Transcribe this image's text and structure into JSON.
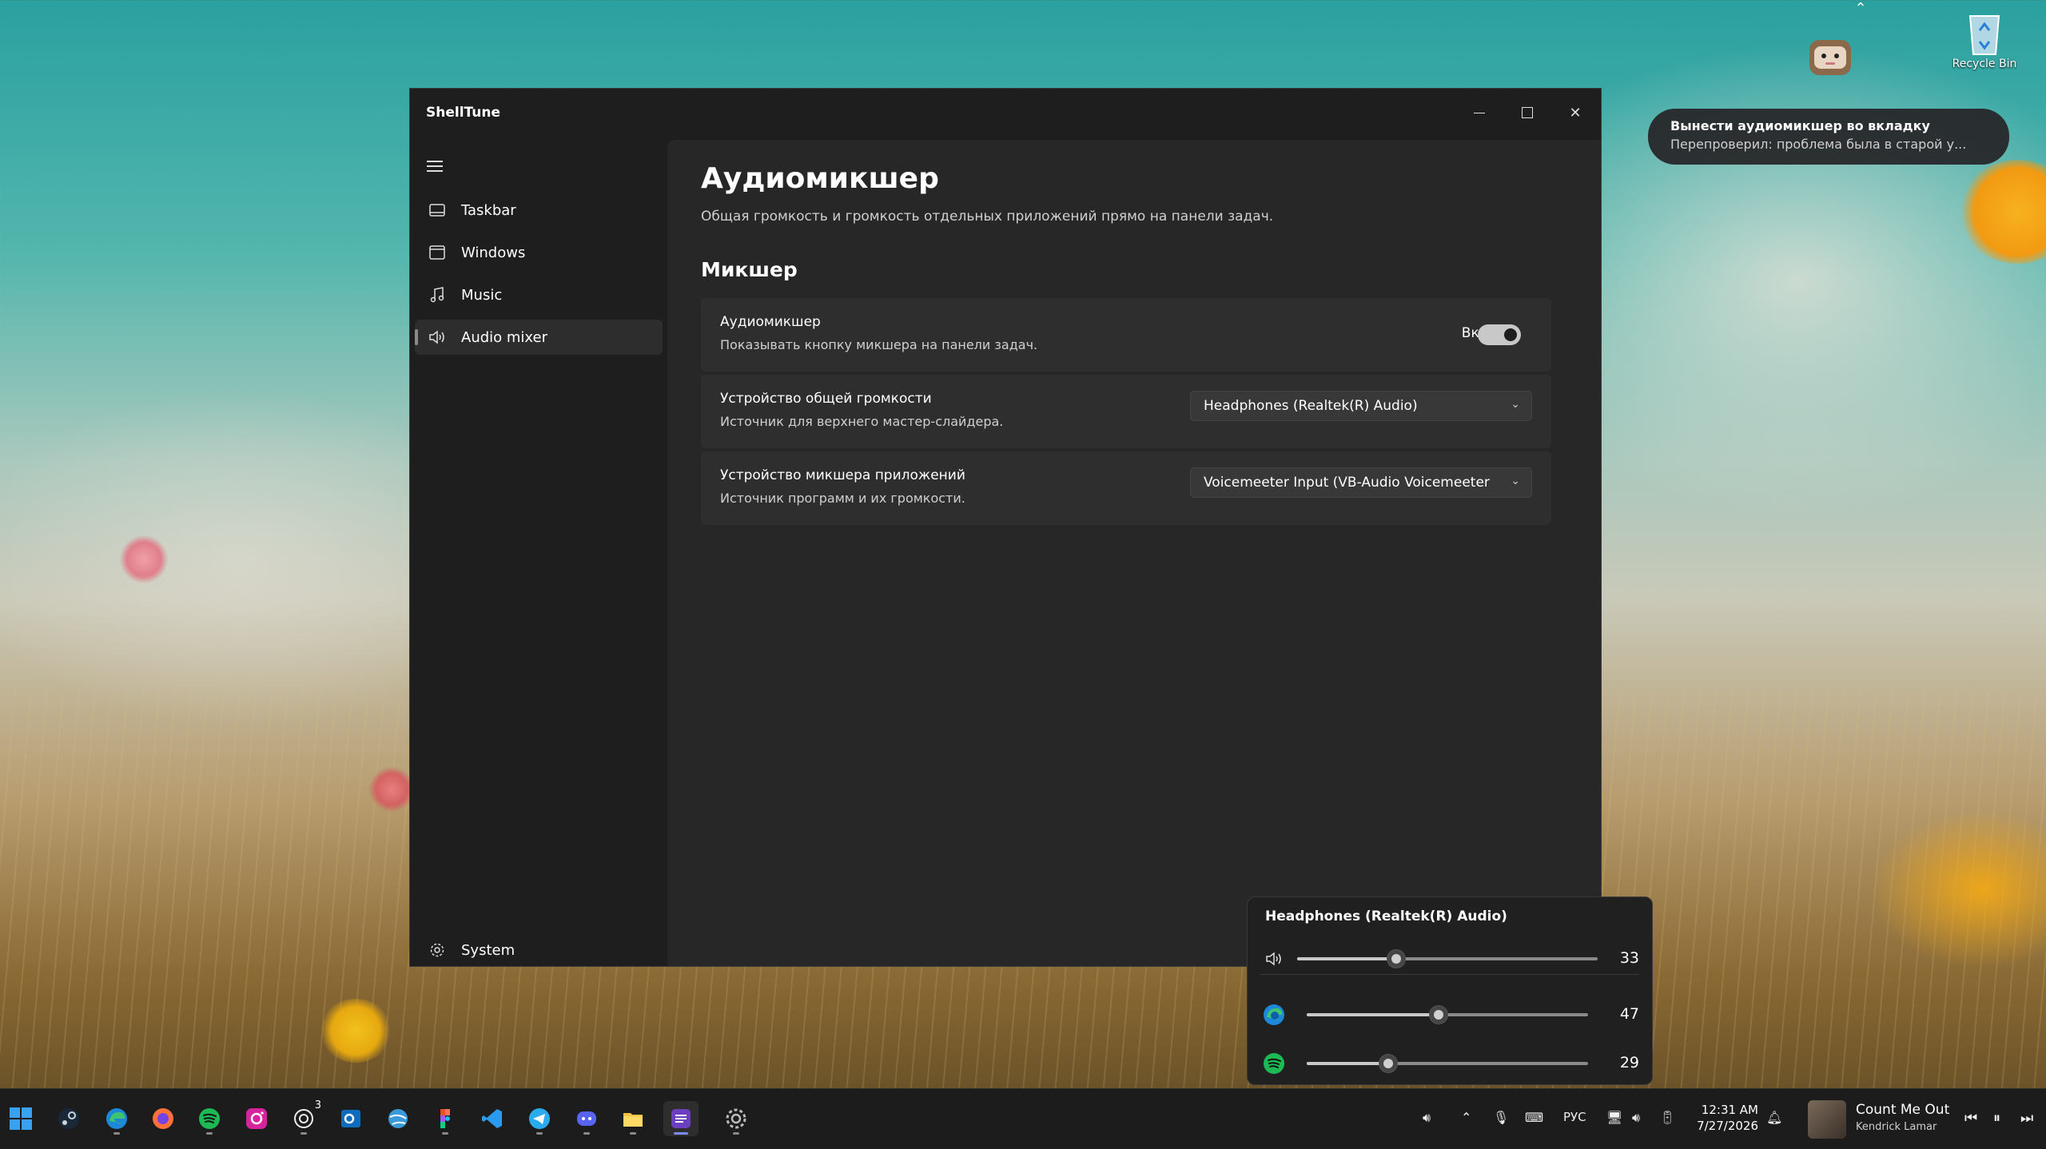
{
  "desktop": {
    "recycle_bin_label": "Recycle Bin"
  },
  "notification": {
    "title": "Вынести аудиомикшер во вкладку",
    "body": "Перепроверил: проблема была в старой у..."
  },
  "window": {
    "title": "ShellTune",
    "controls": {
      "minimize": "—",
      "maximize": "☐",
      "close": "✕"
    }
  },
  "sidebar": {
    "items": [
      {
        "label": "Taskbar",
        "icon": "taskbar-icon"
      },
      {
        "label": "Windows",
        "icon": "window-icon"
      },
      {
        "label": "Music",
        "icon": "music-note-icon"
      },
      {
        "label": "Audio mixer",
        "icon": "speaker-icon",
        "active": true
      }
    ],
    "footer": {
      "label": "System",
      "icon": "gear-icon"
    }
  },
  "page": {
    "title": "Аудиомикшер",
    "subtitle": "Общая громкость и громкость отдельных приложений прямо на панели задач.",
    "section_title": "Микшер",
    "cards": {
      "mixer_toggle": {
        "header": "Аудиомикшер",
        "description": "Показывать кнопку микшера на панели задач.",
        "state_label": "Вкл.",
        "on": true
      },
      "master_device": {
        "header": "Устройство общей громкости",
        "description": "Источник для верхнего мастер-слайдера.",
        "selected": "Headphones (Realtek(R) Audio)"
      },
      "app_device": {
        "header": "Устройство микшера приложений",
        "description": "Источник программ и их громкости.",
        "selected": "Voicemeeter Input (VB-Audio Voicemeeter VAIO)"
      }
    }
  },
  "mixer_flyout": {
    "device_name": "Headphones (Realtek(R) Audio)",
    "master": {
      "icon": "speaker-icon",
      "value": 33
    },
    "apps": [
      {
        "icon": "edge-icon",
        "value": 47
      },
      {
        "icon": "spotify-icon",
        "value": 29
      }
    ]
  },
  "taskbar": {
    "tray": {
      "language": "РУС",
      "time": "12:31 AM",
      "date": "7/27/2026"
    },
    "media": {
      "song": "Count Me Out",
      "artist": "Kendrick Lamar"
    },
    "badge_count": "3"
  },
  "colors": {
    "accent": "#7c8cff",
    "window_bg": "#1e1e1e",
    "content_bg": "#272727",
    "card_bg": "#2e2e2e"
  }
}
